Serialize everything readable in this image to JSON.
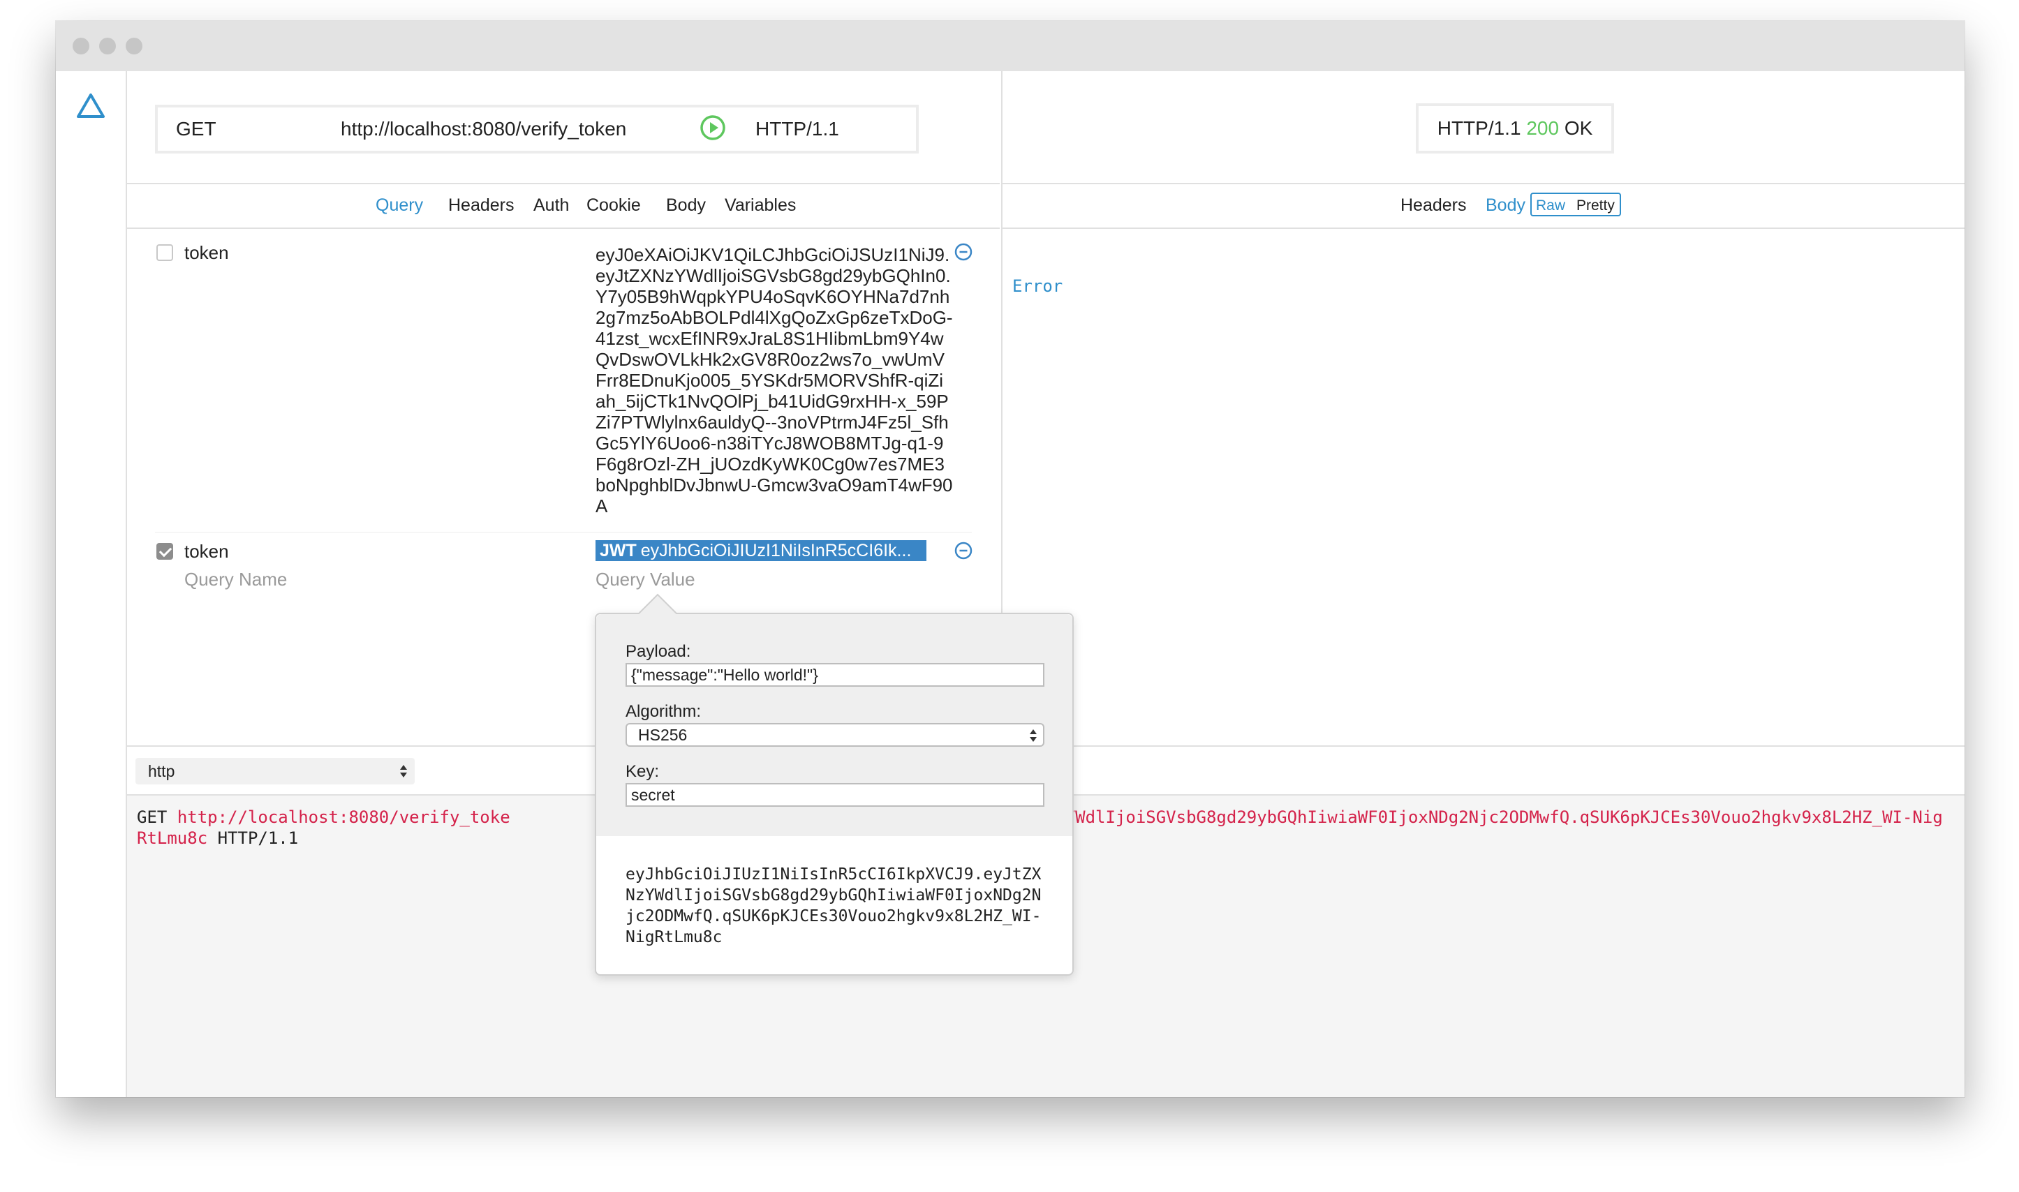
{
  "request": {
    "method": "GET",
    "url": "http://localhost:8080/verify_token",
    "protocol": "HTTP/1.1"
  },
  "request_tabs": [
    "Query",
    "Headers",
    "Auth",
    "Cookie",
    "Body",
    "Variables"
  ],
  "query_params": [
    {
      "enabled": false,
      "name": "token",
      "value": "eyJ0eXAiOiJKV1QiLCJhbGciOiJSUzI1NiJ9.eyJtZXNzYWdlIjoiSGVsbG8gd29ybGQhIn0.Y7y05B9hWqpkYPU4oSqvK6OYHNa7d7nh2g7mz5oAbBOLPdl4lXgQoZxGp6zeTxDoG-41zst_wcxEfINR9xJraL8S1HIibmLbm9Y4wQvDswOVLkHk2xGV8R0oz2ws7o_vwUmVFrr8EDnuKjo005_5YSKdr5MORVShfR-qiZiah_5ijCTk1NvQOlPj_b41UidG9rxHH-x_59PZi7PTWlylnx6auldyQ--3noVPtrmJ4Fz5l_SfhGc5YlY6Uoo6-n38iTYcJ8WOB8MTJg-q1-9F6g8rOzl-ZH_jUOzdKyWK0Cg0w7es7ME3boNpghblDvJbnwU-Gmcw3vaO9amT4wF90A"
    },
    {
      "enabled": true,
      "name": "token",
      "value_badge": "JWT",
      "value": "eyJhbGciOiJIUzI1NiIsInR5cCI6Ik..."
    }
  ],
  "new_param": {
    "name_placeholder": "Query Name",
    "value_placeholder": "Query Value"
  },
  "response": {
    "protocol": "HTTP/1.1",
    "status_code": "200",
    "status_text": "OK",
    "tabs": [
      "Headers",
      "Body"
    ],
    "view_modes": [
      "Raw",
      "Pretty"
    ],
    "body": "Error"
  },
  "bottom": {
    "select_value": "http",
    "code_method": "GET",
    "code_url_prefix": "http://localhost:8080/verify_toke",
    "code_url_suffix": ".eyJtZXNzYWdlIjoiSGVsbG8gd29ybGQhIiwiaWF0IjoxNDg2Njc2ODMwfQ.qSUK6pKJCEs30Vouo2hgkv9x8L2HZ_WI-NigRtLmu8c",
    "code_protocol": "HTTP/1.1"
  },
  "jwt_popover": {
    "payload_label": "Payload:",
    "payload_value": "{\"message\":\"Hello world!\"}",
    "algorithm_label": "Algorithm:",
    "algorithm_value": "HS256",
    "key_label": "Key:",
    "key_value": "secret",
    "output": "eyJhbGciOiJIUzI1NiIsInR5cCI6IkpXVCJ9.eyJtZXNzYWdlIjoiSGVsbG8gd29ybGQhIiwiaWF0IjoxNDg2Njc2ODMwfQ.qSUK6pKJCEs30Vouo2hgkv9x8L2HZ_WI-NigRtLmu8c"
  },
  "colors": {
    "accent": "#2f8fcb",
    "status_ok": "#5ec75e",
    "code_red": "#d4224a",
    "chip_blue": "#3a86c6"
  },
  "icons": {
    "logo": "triangle-logo-icon",
    "send": "play-circle-icon",
    "remove": "minus-circle-icon"
  }
}
